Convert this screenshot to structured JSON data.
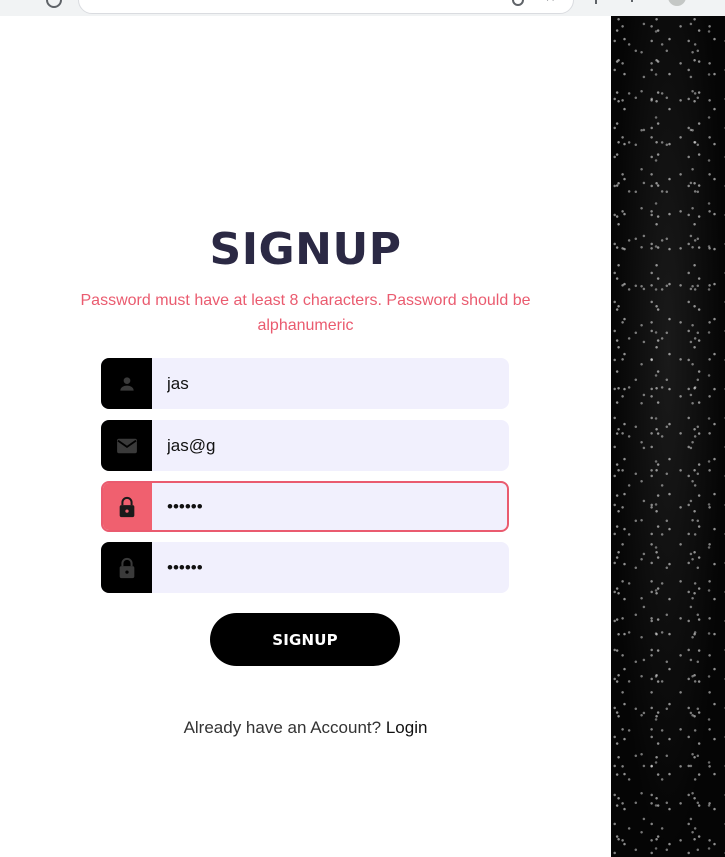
{
  "signup": {
    "title": "SIGNUP",
    "error_message": "Password must have at least 8 characters. Password should be alphanumeric",
    "fields": [
      {
        "icon": "person-icon",
        "value": "jas",
        "type": "text"
      },
      {
        "icon": "email-icon",
        "value": "jas@g",
        "type": "email"
      },
      {
        "icon": "lock-icon",
        "value": "123456",
        "type": "password"
      },
      {
        "icon": "lock-icon",
        "value": "123456",
        "type": "password"
      }
    ],
    "submit_label": "SIGNUP",
    "login_prompt": "Already have an Account?",
    "login_link": "Login"
  },
  "colors": {
    "title": "#2b2944",
    "error": "#ea5b6f",
    "field_bg": "#f1f0fd",
    "icon_box": "#000000",
    "icon_box_error": "#f0606f",
    "button": "#000000"
  }
}
